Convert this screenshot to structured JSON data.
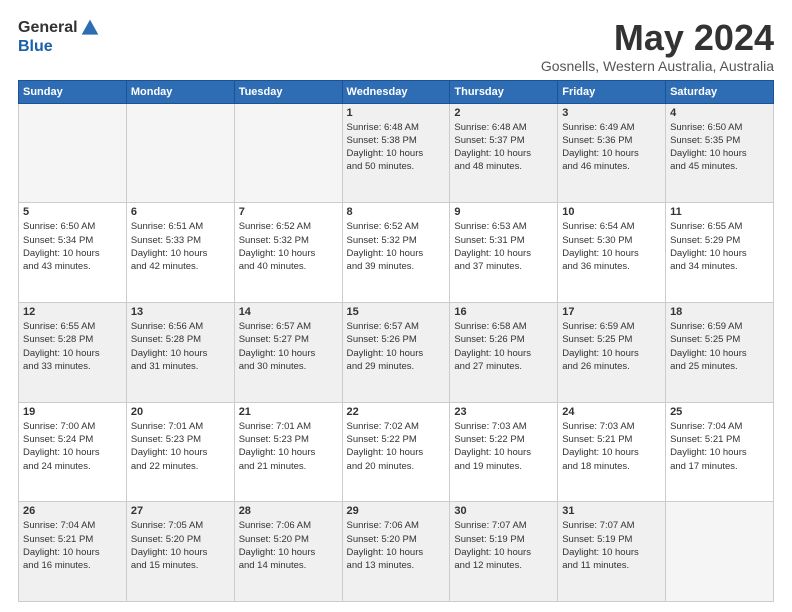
{
  "header": {
    "logo_general": "General",
    "logo_blue": "Blue",
    "month_title": "May 2024",
    "location": "Gosnells, Western Australia, Australia"
  },
  "weekdays": [
    "Sunday",
    "Monday",
    "Tuesday",
    "Wednesday",
    "Thursday",
    "Friday",
    "Saturday"
  ],
  "rows": [
    [
      {
        "day": "",
        "info": "",
        "empty": true
      },
      {
        "day": "",
        "info": "",
        "empty": true
      },
      {
        "day": "",
        "info": "",
        "empty": true
      },
      {
        "day": "1",
        "info": "Sunrise: 6:48 AM\nSunset: 5:38 PM\nDaylight: 10 hours\nand 50 minutes.",
        "empty": false
      },
      {
        "day": "2",
        "info": "Sunrise: 6:48 AM\nSunset: 5:37 PM\nDaylight: 10 hours\nand 48 minutes.",
        "empty": false
      },
      {
        "day": "3",
        "info": "Sunrise: 6:49 AM\nSunset: 5:36 PM\nDaylight: 10 hours\nand 46 minutes.",
        "empty": false
      },
      {
        "day": "4",
        "info": "Sunrise: 6:50 AM\nSunset: 5:35 PM\nDaylight: 10 hours\nand 45 minutes.",
        "empty": false
      }
    ],
    [
      {
        "day": "5",
        "info": "Sunrise: 6:50 AM\nSunset: 5:34 PM\nDaylight: 10 hours\nand 43 minutes.",
        "empty": false
      },
      {
        "day": "6",
        "info": "Sunrise: 6:51 AM\nSunset: 5:33 PM\nDaylight: 10 hours\nand 42 minutes.",
        "empty": false
      },
      {
        "day": "7",
        "info": "Sunrise: 6:52 AM\nSunset: 5:32 PM\nDaylight: 10 hours\nand 40 minutes.",
        "empty": false
      },
      {
        "day": "8",
        "info": "Sunrise: 6:52 AM\nSunset: 5:32 PM\nDaylight: 10 hours\nand 39 minutes.",
        "empty": false
      },
      {
        "day": "9",
        "info": "Sunrise: 6:53 AM\nSunset: 5:31 PM\nDaylight: 10 hours\nand 37 minutes.",
        "empty": false
      },
      {
        "day": "10",
        "info": "Sunrise: 6:54 AM\nSunset: 5:30 PM\nDaylight: 10 hours\nand 36 minutes.",
        "empty": false
      },
      {
        "day": "11",
        "info": "Sunrise: 6:55 AM\nSunset: 5:29 PM\nDaylight: 10 hours\nand 34 minutes.",
        "empty": false
      }
    ],
    [
      {
        "day": "12",
        "info": "Sunrise: 6:55 AM\nSunset: 5:28 PM\nDaylight: 10 hours\nand 33 minutes.",
        "empty": false
      },
      {
        "day": "13",
        "info": "Sunrise: 6:56 AM\nSunset: 5:28 PM\nDaylight: 10 hours\nand 31 minutes.",
        "empty": false
      },
      {
        "day": "14",
        "info": "Sunrise: 6:57 AM\nSunset: 5:27 PM\nDaylight: 10 hours\nand 30 minutes.",
        "empty": false
      },
      {
        "day": "15",
        "info": "Sunrise: 6:57 AM\nSunset: 5:26 PM\nDaylight: 10 hours\nand 29 minutes.",
        "empty": false
      },
      {
        "day": "16",
        "info": "Sunrise: 6:58 AM\nSunset: 5:26 PM\nDaylight: 10 hours\nand 27 minutes.",
        "empty": false
      },
      {
        "day": "17",
        "info": "Sunrise: 6:59 AM\nSunset: 5:25 PM\nDaylight: 10 hours\nand 26 minutes.",
        "empty": false
      },
      {
        "day": "18",
        "info": "Sunrise: 6:59 AM\nSunset: 5:25 PM\nDaylight: 10 hours\nand 25 minutes.",
        "empty": false
      }
    ],
    [
      {
        "day": "19",
        "info": "Sunrise: 7:00 AM\nSunset: 5:24 PM\nDaylight: 10 hours\nand 24 minutes.",
        "empty": false
      },
      {
        "day": "20",
        "info": "Sunrise: 7:01 AM\nSunset: 5:23 PM\nDaylight: 10 hours\nand 22 minutes.",
        "empty": false
      },
      {
        "day": "21",
        "info": "Sunrise: 7:01 AM\nSunset: 5:23 PM\nDaylight: 10 hours\nand 21 minutes.",
        "empty": false
      },
      {
        "day": "22",
        "info": "Sunrise: 7:02 AM\nSunset: 5:22 PM\nDaylight: 10 hours\nand 20 minutes.",
        "empty": false
      },
      {
        "day": "23",
        "info": "Sunrise: 7:03 AM\nSunset: 5:22 PM\nDaylight: 10 hours\nand 19 minutes.",
        "empty": false
      },
      {
        "day": "24",
        "info": "Sunrise: 7:03 AM\nSunset: 5:21 PM\nDaylight: 10 hours\nand 18 minutes.",
        "empty": false
      },
      {
        "day": "25",
        "info": "Sunrise: 7:04 AM\nSunset: 5:21 PM\nDaylight: 10 hours\nand 17 minutes.",
        "empty": false
      }
    ],
    [
      {
        "day": "26",
        "info": "Sunrise: 7:04 AM\nSunset: 5:21 PM\nDaylight: 10 hours\nand 16 minutes.",
        "empty": false
      },
      {
        "day": "27",
        "info": "Sunrise: 7:05 AM\nSunset: 5:20 PM\nDaylight: 10 hours\nand 15 minutes.",
        "empty": false
      },
      {
        "day": "28",
        "info": "Sunrise: 7:06 AM\nSunset: 5:20 PM\nDaylight: 10 hours\nand 14 minutes.",
        "empty": false
      },
      {
        "day": "29",
        "info": "Sunrise: 7:06 AM\nSunset: 5:20 PM\nDaylight: 10 hours\nand 13 minutes.",
        "empty": false
      },
      {
        "day": "30",
        "info": "Sunrise: 7:07 AM\nSunset: 5:19 PM\nDaylight: 10 hours\nand 12 minutes.",
        "empty": false
      },
      {
        "day": "31",
        "info": "Sunrise: 7:07 AM\nSunset: 5:19 PM\nDaylight: 10 hours\nand 11 minutes.",
        "empty": false
      },
      {
        "day": "",
        "info": "",
        "empty": true
      }
    ]
  ],
  "gray_rows": [
    0,
    2,
    4
  ],
  "colors": {
    "header_bg": "#2e6db4",
    "header_text": "#ffffff",
    "empty_bg": "#f5f5f5",
    "gray_bg": "#f0f0f0",
    "white_bg": "#ffffff"
  }
}
